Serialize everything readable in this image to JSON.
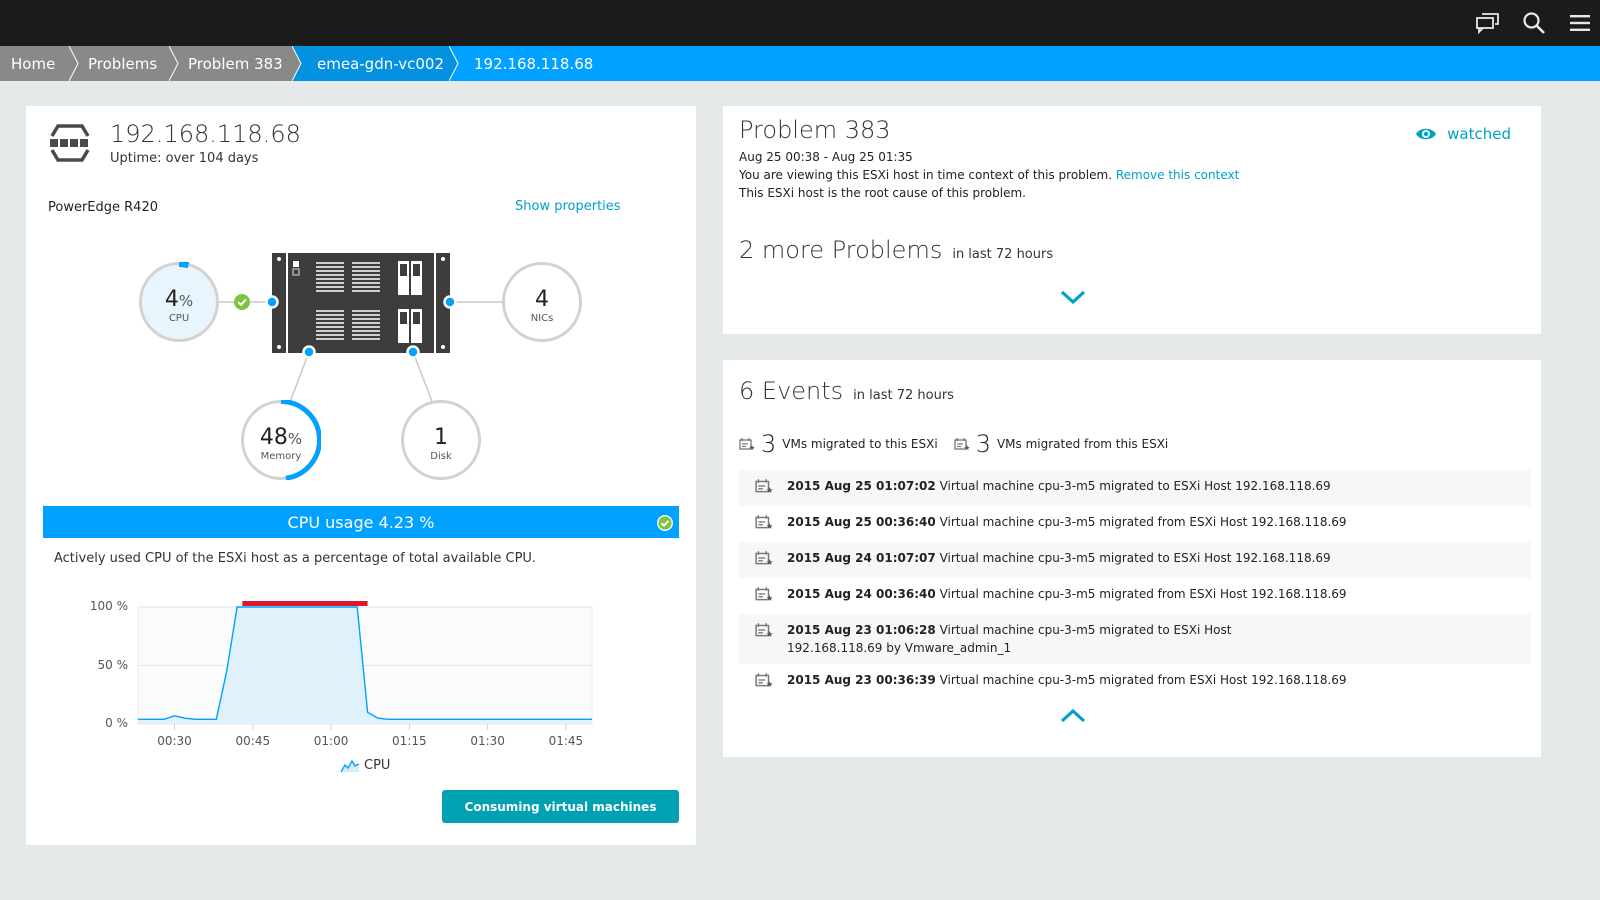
{
  "topbar": {
    "icons": [
      "chat-icon",
      "search-icon",
      "menu-icon"
    ]
  },
  "breadcrumb": [
    {
      "label": "Home"
    },
    {
      "label": "Problems"
    },
    {
      "label": "Problem 383"
    },
    {
      "label": "emea-gdn-vc002"
    },
    {
      "label": "192.168.118.68"
    }
  ],
  "host": {
    "ip": "192.168.118.68",
    "uptime": "Uptime: over 104 days",
    "model": "PowerEdge R420",
    "show_properties": "Show properties",
    "metrics": {
      "cpu": {
        "value": "4",
        "unit": "%",
        "label": "CPU",
        "fraction": 0.04
      },
      "memory": {
        "value": "48",
        "unit": "%",
        "label": "Memory",
        "fraction": 0.48
      },
      "nics": {
        "value": "4",
        "label": "NICs"
      },
      "disk": {
        "value": "1",
        "label": "Disk"
      }
    },
    "usage_bar": "CPU usage 4.23 %",
    "usage_desc": "Actively used CPU of the ESXi host as a percentage of total available CPU.",
    "consume_button": "Consuming virtual machines"
  },
  "chart_data": {
    "type": "area",
    "title": "",
    "xlabel": "",
    "ylabel": "",
    "ylim": [
      0,
      100
    ],
    "xlim_minutes": [
      23,
      110
    ],
    "y_ticks": [
      "100 %",
      "50 %",
      "0 %"
    ],
    "y_tick_values": [
      100,
      50,
      0
    ],
    "x_ticks": [
      "00:30",
      "00:45",
      "01:00",
      "01:15",
      "01:30",
      "01:45"
    ],
    "x_tick_values_minutes": [
      30,
      45,
      60,
      75,
      90,
      105
    ],
    "legend": [
      "CPU"
    ],
    "problem_window_minutes": [
      43,
      67
    ],
    "series": [
      {
        "name": "CPU",
        "x_minutes": [
          23,
          26,
          28,
          30,
          32,
          34,
          36,
          38,
          40,
          42,
          44,
          46,
          50,
          55,
          60,
          64,
          65,
          67,
          69,
          71,
          75,
          80,
          85,
          90,
          95,
          100,
          105,
          110
        ],
        "values": [
          4,
          4,
          4,
          7,
          5,
          4,
          4,
          4,
          45,
          100,
          100,
          100,
          100,
          100,
          100,
          100,
          100,
          10,
          5,
          4,
          4,
          4,
          4,
          4,
          4,
          4,
          4,
          4
        ]
      }
    ]
  },
  "problem": {
    "title": "Problem 383",
    "time_range": "Aug 25 00:38 - Aug 25 01:35",
    "context_text": "You are viewing this ESXi host in time context of this problem.",
    "remove_context": "Remove this context",
    "root_cause": "This ESXi host is the root cause of this problem.",
    "watched": "watched",
    "more_title": "2 more Problems",
    "more_sub": "in last 72 hours"
  },
  "events": {
    "title": "6 Events",
    "sub": "in last 72 hours",
    "summary": [
      {
        "count": "3",
        "label": "VMs migrated to this ESXi"
      },
      {
        "count": "3",
        "label": "VMs migrated from this ESXi"
      }
    ],
    "items": [
      {
        "time": "2015 Aug 25 01:07:02",
        "text": " Virtual machine cpu-3-m5 migrated to ESXi Host 192.168.118.69"
      },
      {
        "time": "2015 Aug 25 00:36:40",
        "text": " Virtual machine cpu-3-m5 migrated from ESXi Host 192.168.118.69"
      },
      {
        "time": "2015 Aug 24 01:07:07",
        "text": " Virtual machine cpu-3-m5 migrated to ESXi Host 192.168.118.69"
      },
      {
        "time": "2015 Aug 24 00:36:40",
        "text": " Virtual machine cpu-3-m5 migrated from ESXi Host 192.168.118.69"
      },
      {
        "time": "2015 Aug 23 01:06:28",
        "text": " Virtual machine cpu-3-m5 migrated to ESXi Host 192.168.118.69 by Vmware_admin_1"
      },
      {
        "time": "2015 Aug 23 00:36:39",
        "text": " Virtual machine cpu-3-m5 migrated from ESXi Host 192.168.118.69"
      }
    ]
  },
  "colors": {
    "accent_blue": "#00a1ff",
    "dark_blue": "#0391e0",
    "teal": "#00a1c9",
    "button_teal": "#00a1b2",
    "problem_red": "#dc172a",
    "ok_green": "#7dc540",
    "topbar": "#1b1b1b",
    "crumb_grey": "#898989"
  }
}
